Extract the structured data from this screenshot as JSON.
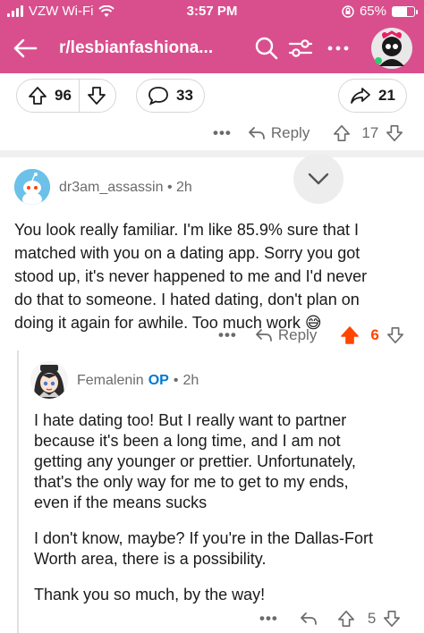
{
  "status": {
    "carrier": "VZW Wi-Fi",
    "time": "3:57 PM",
    "battery": "65%",
    "battery_level": 0.65
  },
  "nav": {
    "subreddit": "r/lesbianfashiona..."
  },
  "post": {
    "upvotes": "96",
    "comments": "33",
    "shares": "21"
  },
  "comment0": {
    "reply_label": "Reply",
    "score": "17"
  },
  "comment1": {
    "author": "dr3am_assassin",
    "age": "2h",
    "lines": [
      "You look really familiar. I'm like 85.9% sure that I",
      "matched with you on a dating app. Sorry you got",
      "stood up, it's never happened to me and I'd never",
      "do that to someone.  I hated dating, don't plan on",
      "doing it again for awhile. Too much work 😅"
    ],
    "reply_label": "Reply",
    "score": "6"
  },
  "comment2": {
    "author": "Femalenin",
    "op_badge": "OP",
    "age": "2h",
    "paragraphs": [
      [
        "I hate dating too! But I really want to partner",
        "because it's been a long time, and I am not",
        "getting any younger or prettier. Unfortunately,",
        "that's the only way for me to get to my ends,",
        "even if the means sucks"
      ],
      [
        "I don't know, maybe? If you're in the Dallas-Fort",
        "Worth area, there is a possibility."
      ],
      [
        "Thank you so much, by the way!"
      ]
    ],
    "score": "5"
  },
  "colors": {
    "header": "#d94f8e",
    "upvote_active": "#ff4500",
    "op": "#0079d3"
  }
}
